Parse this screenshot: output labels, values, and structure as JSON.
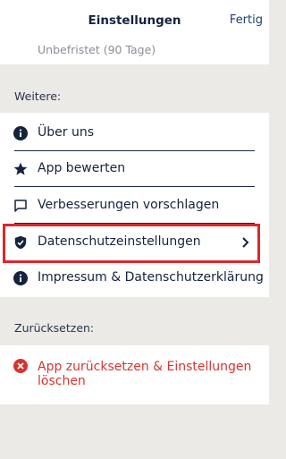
{
  "navbar": {
    "title": "Einstellungen",
    "done_label": "Fertig"
  },
  "top_card": {
    "subtitle": "Unbefristet (90 Tage)"
  },
  "sections": {
    "more_label": "Weitere:",
    "reset_label": "Zurücksetzen:"
  },
  "more_items": [
    {
      "label": "Über uns",
      "icon": "info-icon"
    },
    {
      "label": "App bewerten",
      "icon": "star-icon"
    },
    {
      "label": "Verbesserungen vorschlagen",
      "icon": "comment-icon"
    },
    {
      "label": "Datenschutzeinstellungen",
      "icon": "shield-check-icon",
      "has_chevron": true,
      "highlighted": true
    },
    {
      "label": "Impressum & Datenschutzerklärung",
      "icon": "info-icon"
    }
  ],
  "reset_item": {
    "line1": "App zurücksetzen & Einstellungen",
    "line2": "löschen",
    "icon": "error-icon"
  },
  "colors": {
    "primary": "#15233d",
    "destructive": "#d6352f",
    "highlight_box": "#e0252b",
    "background": "#eceae7"
  }
}
